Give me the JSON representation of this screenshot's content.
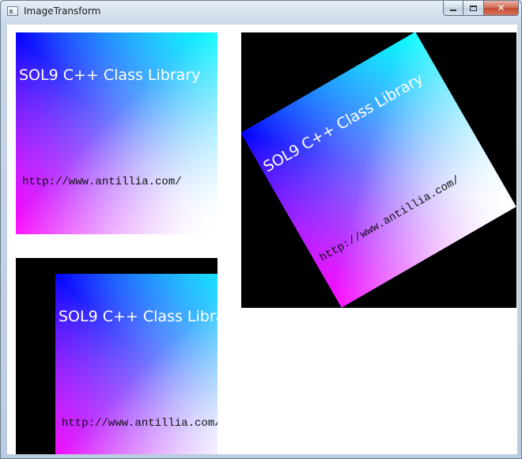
{
  "window": {
    "title": "ImageTransform"
  },
  "caption_buttons": {
    "close_glyph": "✕"
  },
  "image": {
    "title": "SOL9 C++ Class Library",
    "url": "http://www.antillia.com/"
  },
  "colors": {
    "gradient_top_left": "#0000ff",
    "gradient_top_right": "#00ffff",
    "gradient_bottom_left": "#ff00ff",
    "gradient_bottom_right": "#ffffff",
    "panel_background": "#000000",
    "client_background": "#ffffff"
  },
  "transforms": {
    "rotation_degrees": -30
  }
}
